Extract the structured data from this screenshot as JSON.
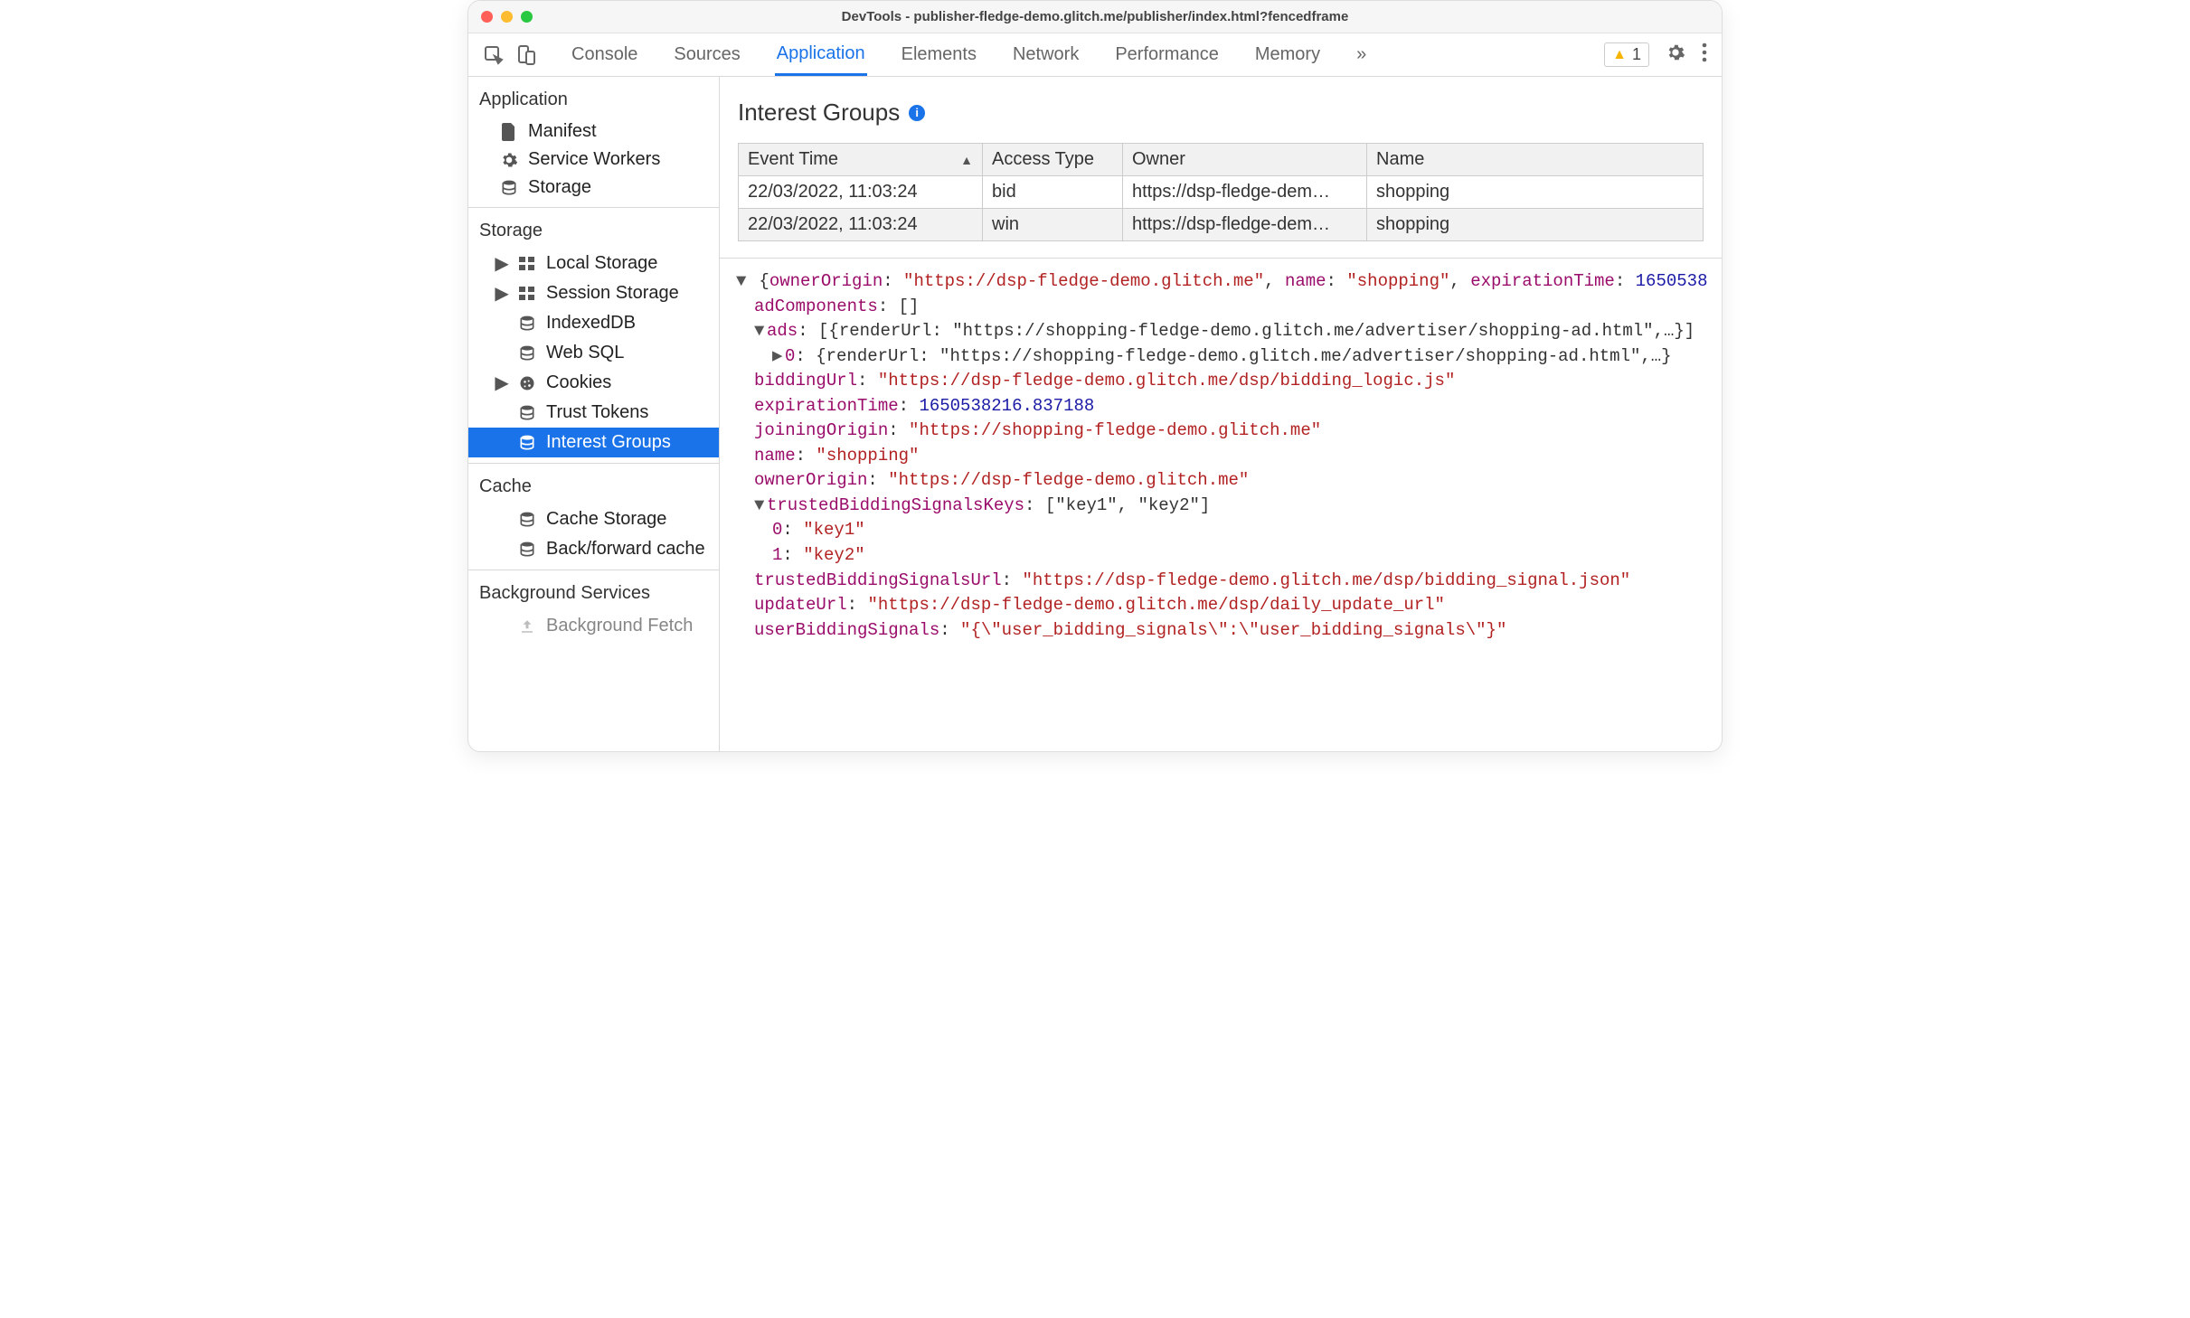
{
  "window": {
    "title": "DevTools - publisher-fledge-demo.glitch.me/publisher/index.html?fencedframe"
  },
  "toolbar": {
    "tabs": [
      "Console",
      "Sources",
      "Application",
      "Elements",
      "Network",
      "Performance",
      "Memory"
    ],
    "activeTab": "Application",
    "more": "»",
    "warnCount": "1"
  },
  "sidebar": {
    "sections": [
      {
        "title": "Application",
        "items": [
          {
            "name": "manifest",
            "label": "Manifest",
            "icon": "file"
          },
          {
            "name": "service-workers",
            "label": "Service Workers",
            "icon": "gear"
          },
          {
            "name": "storage",
            "label": "Storage",
            "icon": "db"
          }
        ]
      },
      {
        "title": "Storage",
        "items": [
          {
            "name": "local-storage",
            "label": "Local Storage",
            "icon": "grid",
            "expandable": true
          },
          {
            "name": "session-storage",
            "label": "Session Storage",
            "icon": "grid",
            "expandable": true
          },
          {
            "name": "indexeddb",
            "label": "IndexedDB",
            "icon": "db"
          },
          {
            "name": "web-sql",
            "label": "Web SQL",
            "icon": "db"
          },
          {
            "name": "cookies",
            "label": "Cookies",
            "icon": "cookie",
            "expandable": true
          },
          {
            "name": "trust-tokens",
            "label": "Trust Tokens",
            "icon": "db"
          },
          {
            "name": "interest-groups",
            "label": "Interest Groups",
            "icon": "db",
            "active": true
          }
        ]
      },
      {
        "title": "Cache",
        "items": [
          {
            "name": "cache-storage",
            "label": "Cache Storage",
            "icon": "db"
          },
          {
            "name": "bfcache",
            "label": "Back/forward cache",
            "icon": "db"
          }
        ]
      },
      {
        "title": "Background Services",
        "items": [
          {
            "name": "background-fetch",
            "label": "Background Fetch",
            "icon": "upload"
          }
        ]
      }
    ]
  },
  "main": {
    "title": "Interest Groups",
    "table": {
      "columns": [
        "Event Time",
        "Access Type",
        "Owner",
        "Name"
      ],
      "rows": [
        {
          "eventTime": "22/03/2022, 11:03:24",
          "accessType": "bid",
          "owner": "https://dsp-fledge-demo.gl…",
          "name": "shopping"
        },
        {
          "eventTime": "22/03/2022, 11:03:24",
          "accessType": "win",
          "owner": "https://dsp-fledge-demo.gl…",
          "name": "shopping"
        }
      ]
    },
    "detail": {
      "topLine": {
        "ownerOriginKey": "ownerOrigin",
        "ownerOriginVal": "\"https://dsp-fledge-demo.glitch.me\"",
        "nameKey": "name",
        "nameVal": "\"shopping\"",
        "expTimeKey": "expirationTime",
        "expTimePartial": "1650538"
      },
      "rows": [
        {
          "indent": 1,
          "key": "adComponents",
          "plain": "[]"
        },
        {
          "indent": 1,
          "caret": "▼",
          "key": "ads",
          "plain": "[{renderUrl: \"https://shopping-fledge-demo.glitch.me/advertiser/shopping-ad.html\",…}]"
        },
        {
          "indent": 2,
          "caret": "▶",
          "key": "0",
          "plain": "{renderUrl: \"https://shopping-fledge-demo.glitch.me/advertiser/shopping-ad.html\",…}"
        },
        {
          "indent": 1,
          "key": "biddingUrl",
          "str": "\"https://dsp-fledge-demo.glitch.me/dsp/bidding_logic.js\""
        },
        {
          "indent": 1,
          "key": "expirationTime",
          "num": "1650538216.837188"
        },
        {
          "indent": 1,
          "key": "joiningOrigin",
          "str": "\"https://shopping-fledge-demo.glitch.me\""
        },
        {
          "indent": 1,
          "key": "name",
          "str": "\"shopping\""
        },
        {
          "indent": 1,
          "key": "ownerOrigin",
          "str": "\"https://dsp-fledge-demo.glitch.me\""
        },
        {
          "indent": 1,
          "caret": "▼",
          "key": "trustedBiddingSignalsKeys",
          "plain": "[\"key1\", \"key2\"]"
        },
        {
          "indent": 2,
          "key": "0",
          "str": "\"key1\""
        },
        {
          "indent": 2,
          "key": "1",
          "str": "\"key2\""
        },
        {
          "indent": 1,
          "key": "trustedBiddingSignalsUrl",
          "str": "\"https://dsp-fledge-demo.glitch.me/dsp/bidding_signal.json\""
        },
        {
          "indent": 1,
          "key": "updateUrl",
          "str": "\"https://dsp-fledge-demo.glitch.me/dsp/daily_update_url\""
        },
        {
          "indent": 1,
          "key": "userBiddingSignals",
          "str": "\"{\\\"user_bidding_signals\\\":\\\"user_bidding_signals\\\"}\""
        }
      ]
    }
  }
}
